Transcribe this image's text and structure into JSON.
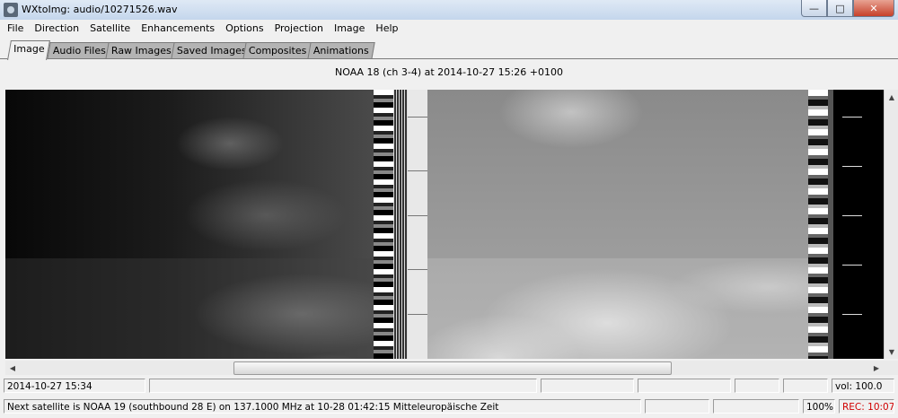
{
  "window": {
    "title": "WXtoImg: audio/10271526.wav",
    "min_label": "—",
    "max_label": "□",
    "close_label": "✕"
  },
  "menu": [
    "File",
    "Direction",
    "Satellite",
    "Enhancements",
    "Options",
    "Projection",
    "Image",
    "Help"
  ],
  "tabs": [
    "Image",
    "Audio Files",
    "Raw Images",
    "Saved Images",
    "Composites",
    "Animations"
  ],
  "active_tab": "Image",
  "image_caption": "NOAA 18 (ch 3-4) at 2014-10-27  15:26 +0100",
  "status": {
    "row1": {
      "datetime": "2014-10-27  15:34",
      "volume": "vol: 100.0"
    },
    "row2": {
      "next_pass": "Next satellite is NOAA 19 (southbound 28 E) on 137.1000 MHz at 10-28 01:42:15 Mitteleuropäische Zeit",
      "zoom": "100%",
      "rec": "REC: 10:07"
    }
  },
  "icons": [
    "app-icon",
    "minimize-icon",
    "maximize-icon",
    "close-icon",
    "scroll-up-icon",
    "scroll-down-icon",
    "scroll-left-icon",
    "scroll-right-icon"
  ],
  "colors": {
    "rec_text": "#d00000",
    "titlebar": "#c4d6ec",
    "close": "#c6402a"
  }
}
